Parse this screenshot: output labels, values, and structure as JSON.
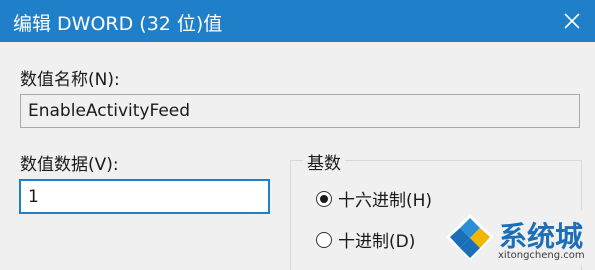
{
  "dialog": {
    "title": "编辑 DWORD (32 位)值",
    "close_icon": "close-icon"
  },
  "value_name": {
    "label": "数值名称(N):",
    "value": "EnableActivityFeed"
  },
  "value_data": {
    "label": "数值数据(V):",
    "value": "1"
  },
  "base": {
    "title": "基数",
    "options": [
      {
        "label": "十六进制(H)",
        "selected": true
      },
      {
        "label": "十进制(D)",
        "selected": false
      }
    ]
  },
  "watermark": {
    "text": "系统城",
    "url": "xitongcheng.com",
    "color": "#1b6fb8"
  },
  "colors": {
    "title_bar": "#1f7fc9",
    "background": "#f0f0f0"
  }
}
